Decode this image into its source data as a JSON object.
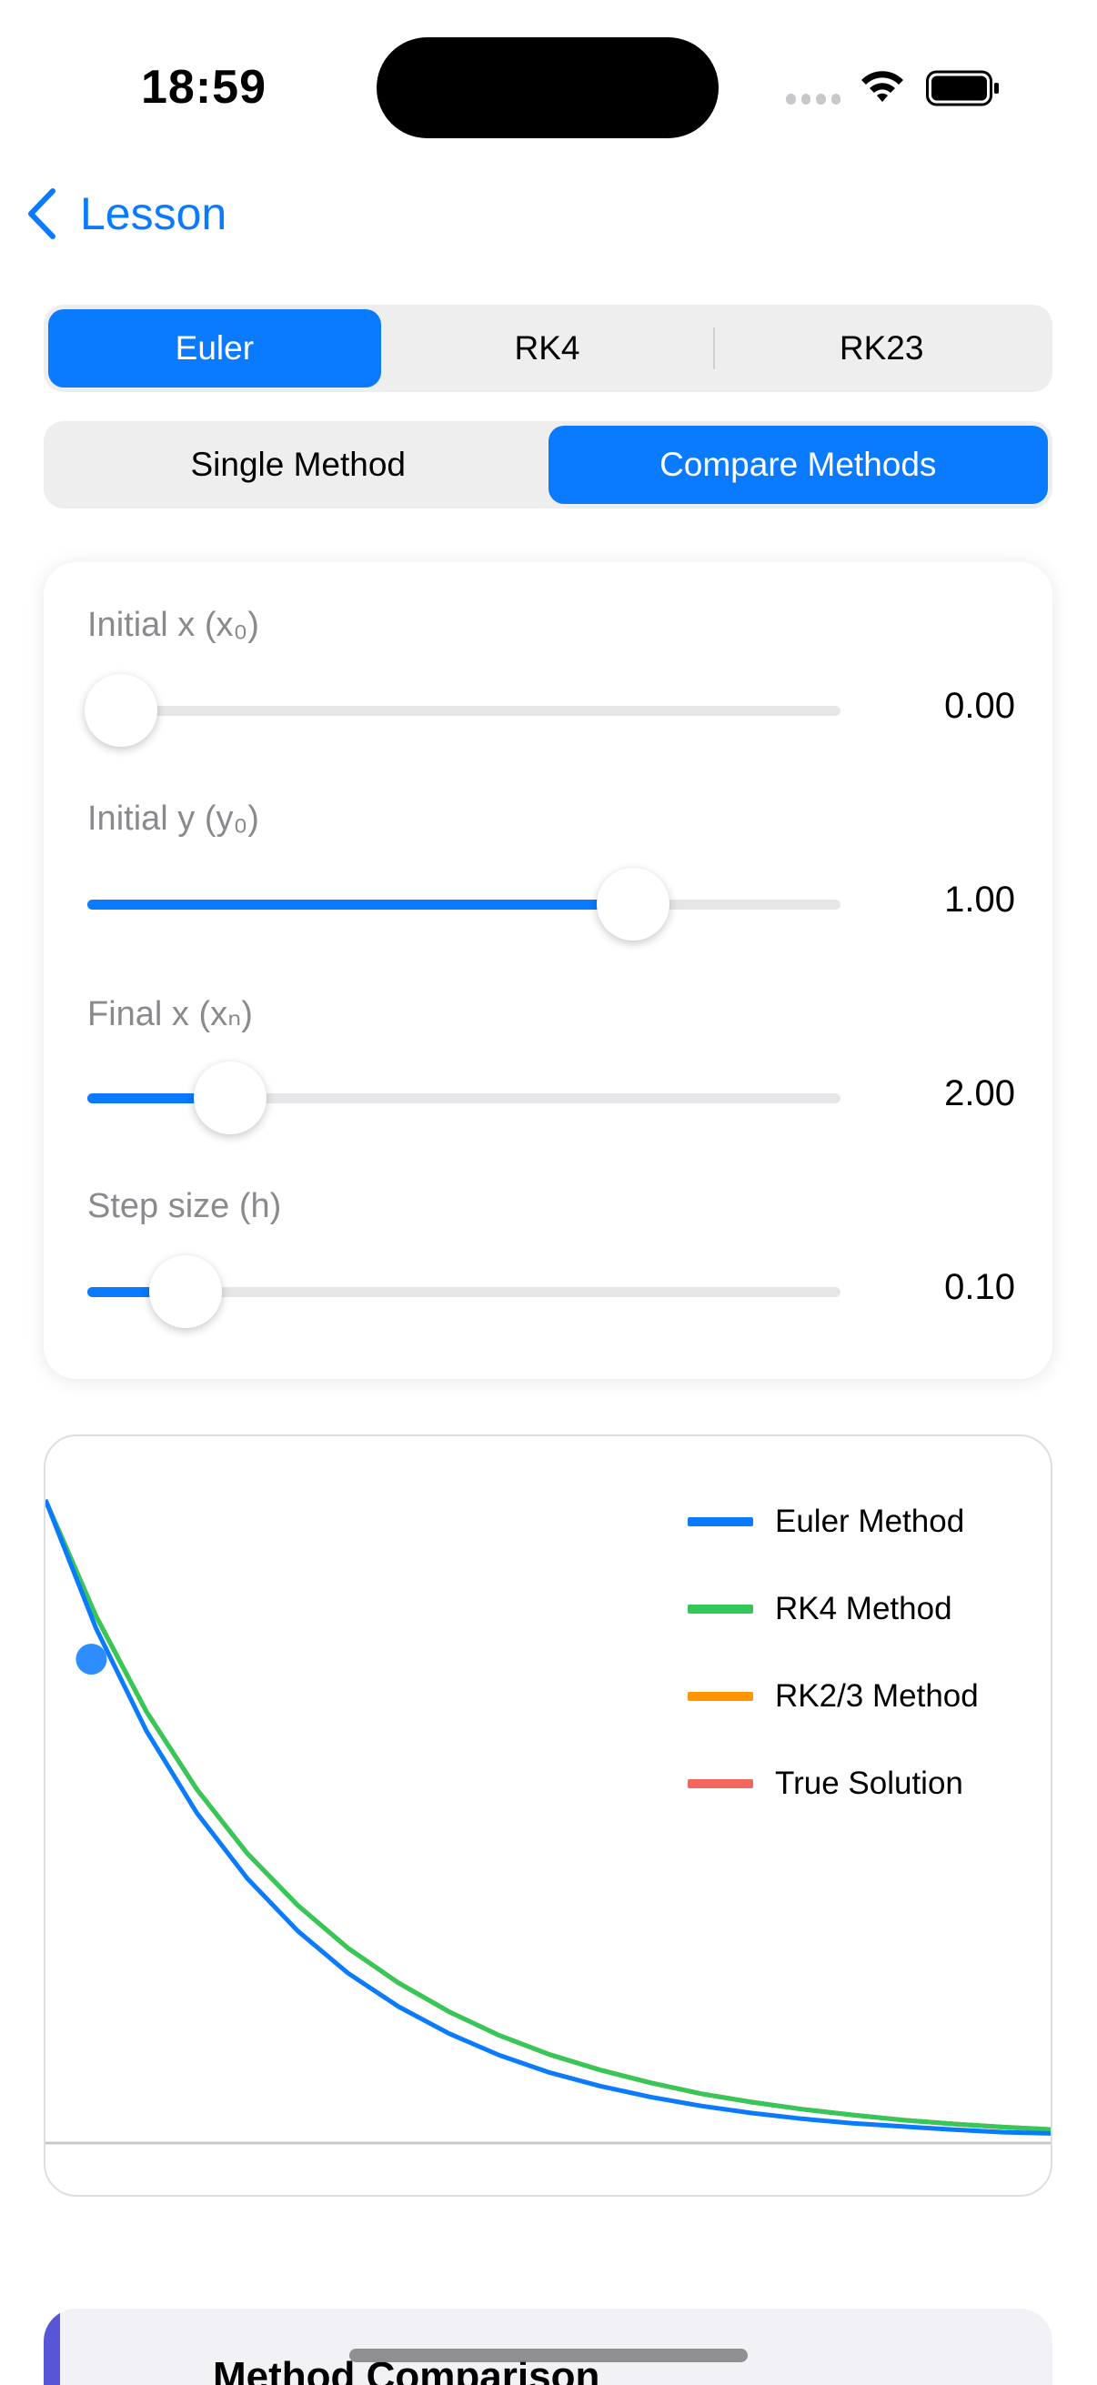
{
  "status_bar": {
    "time": "18:59"
  },
  "nav": {
    "back_label": "Lesson"
  },
  "method_tabs": [
    {
      "label": "Euler",
      "active": true
    },
    {
      "label": "RK4",
      "active": false
    },
    {
      "label": "RK23",
      "active": false
    }
  ],
  "mode_tabs": [
    {
      "label": "Single Method",
      "active": false
    },
    {
      "label": "Compare Methods",
      "active": true
    }
  ],
  "parameters": [
    {
      "label": "Initial x (x₀)",
      "value": "0.00",
      "slider_fraction": 0.045
    },
    {
      "label": "Initial y (y₀)",
      "value": "1.00",
      "slider_fraction": 0.725
    },
    {
      "label": "Final x (xₙ)",
      "value": "2.00",
      "slider_fraction": 0.19
    },
    {
      "label": "Step size (h)",
      "value": "0.10",
      "slider_fraction": 0.13
    }
  ],
  "chart_data": {
    "type": "line",
    "title": "",
    "xlabel": "",
    "ylabel": "",
    "xlim": [
      0,
      2
    ],
    "ylim": [
      0,
      1.0
    ],
    "grid": false,
    "legend_position": "top-right",
    "x": [
      0.0,
      0.1,
      0.2,
      0.3,
      0.4,
      0.5,
      0.6,
      0.7,
      0.8,
      0.9,
      1.0,
      1.1,
      1.2,
      1.3,
      1.4,
      1.5,
      1.6,
      1.7,
      1.8,
      1.9,
      2.0
    ],
    "series": [
      {
        "name": "Euler Method",
        "color": "#0a7aff",
        "values": [
          1.0,
          0.8,
          0.64,
          0.512,
          0.41,
          0.328,
          0.262,
          0.21,
          0.168,
          0.134,
          0.107,
          0.086,
          0.069,
          0.055,
          0.044,
          0.035,
          0.028,
          0.023,
          0.018,
          0.014,
          0.012
        ]
      },
      {
        "name": "RK4 Method",
        "color": "#34c759",
        "values": [
          1.0,
          0.819,
          0.67,
          0.549,
          0.449,
          0.368,
          0.301,
          0.247,
          0.202,
          0.165,
          0.135,
          0.111,
          0.091,
          0.074,
          0.061,
          0.05,
          0.041,
          0.033,
          0.027,
          0.022,
          0.018
        ]
      },
      {
        "name": "RK2/3 Method",
        "color": "#ff9500",
        "values": [
          1.0,
          0.819,
          0.67,
          0.549,
          0.449,
          0.368,
          0.301,
          0.247,
          0.202,
          0.165,
          0.135,
          0.111,
          0.091,
          0.074,
          0.061,
          0.05,
          0.041,
          0.033,
          0.027,
          0.022,
          0.018
        ]
      },
      {
        "name": "True Solution",
        "color": "#f2685f",
        "values": [
          1.0,
          0.819,
          0.67,
          0.549,
          0.449,
          0.368,
          0.301,
          0.247,
          0.202,
          0.165,
          0.135,
          0.111,
          0.091,
          0.074,
          0.061,
          0.05,
          0.041,
          0.033,
          0.027,
          0.022,
          0.018
        ]
      }
    ],
    "marker": {
      "x": 0.1,
      "y": 0.8,
      "color": "#0a7aff"
    }
  },
  "comparison": {
    "title": "Method Comparison"
  }
}
